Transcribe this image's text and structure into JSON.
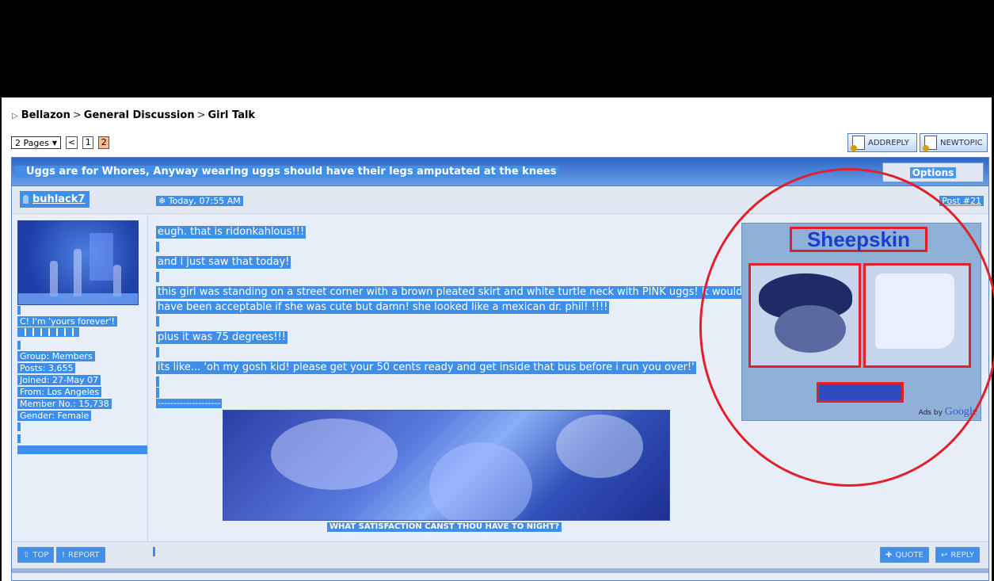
{
  "breadcrumb": {
    "items": [
      "Bellazon",
      "General Discussion",
      "Girl Talk"
    ],
    "separator": ">"
  },
  "pager": {
    "pages_label": "2 Pages",
    "prev": "<",
    "pages": [
      "1",
      "2"
    ],
    "current": "2"
  },
  "toolbar": {
    "add_reply": "ADDREPLY",
    "new_topic": "NEWTOPIC"
  },
  "post": {
    "title": "Uggs are for Whores, Anyway wearing uggs should have their legs amputated at the knees",
    "options_label": "Options",
    "author": "buhlack7",
    "date": "Today, 07:55 AM",
    "post_number": "Post #21",
    "user_title": "C! I'm 'yours forever'!",
    "user_info": [
      "Group: Members",
      "Posts: 3,655",
      "Joined: 27-May 07",
      "From: Los Angeles",
      "Member No.: 15,738",
      "Gender: Female"
    ],
    "lines": [
      "eugh. that is ridonkahlous!!!",
      "and i just saw that today!",
      "this girl was standing on a street corner with a brown pleated skirt and white turtle neck with PINK uggs! It would",
      "have been acceptable if she was cute but damn! she looked like a mexican dr. phil! !!!!",
      "plus it was 75 degrees!!!",
      "its like... 'oh my gosh kid! please get your 50 cents ready and get inside that bus before i run you over!'",
      "--------------------"
    ],
    "signature_caption": "WHAT SATISFACTION CANST THOU HAVE TO NIGHT?"
  },
  "ad": {
    "headline": "Sheepskin",
    "ads_by": "Ads by",
    "google": "Google"
  },
  "footer": {
    "top": "TOP",
    "report": "REPORT",
    "quote": "QUOTE",
    "reply": "REPLY"
  },
  "colors": {
    "highlight": "#3f8fe8",
    "annotation": "#e0202a",
    "title_bar": "#2f67c8"
  }
}
